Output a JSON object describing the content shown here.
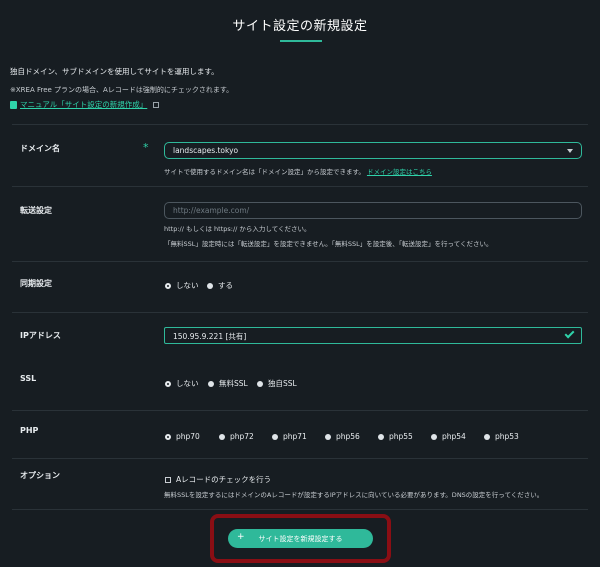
{
  "title": "サイト設定の新規設定",
  "intro": "独自ドメイン、サブドメインを使用してサイトを運用します。",
  "note": "※XREA Free プランの場合、Aレコードは強制的にチェックされます。",
  "manual_link": "マニュアル「サイト設定の新規作成」",
  "domain": {
    "label": "ドメイン名",
    "required_mark": "*",
    "value": "landscapes.tokyo",
    "help": "サイトで使用するドメイン名は「ドメイン設定」から設定できます。",
    "help_link": "ドメイン設定はこちら"
  },
  "redirect": {
    "label": "転送設定",
    "placeholder": "http://example.com/",
    "help1": "http:// もしくは https:// から入力してください。",
    "help2": "「無料SSL」設定時には「転送設定」を設定できません。「無料SSL」を設定後、「転送設定」を行ってください。"
  },
  "sync": {
    "label": "同期設定",
    "options": [
      "しない",
      "する"
    ],
    "selected": "しない"
  },
  "ip": {
    "label": "IPアドレス",
    "value": "150.95.9.221 [共有]"
  },
  "ssl": {
    "label": "SSL",
    "options": [
      "しない",
      "無料SSL",
      "独自SSL"
    ],
    "selected": "しない"
  },
  "php": {
    "label": "PHP",
    "options": [
      "php70",
      "php72",
      "php71",
      "php56",
      "php55",
      "php54",
      "php53"
    ],
    "selected": "php70"
  },
  "option": {
    "label": "オプション",
    "checkbox": "Aレコードのチェックを行う",
    "help": "無料SSLを設定するにはドメインのAレコードが設定するIPアドレスに向いている必要があります。DNSの設定を行ってください。"
  },
  "submit": {
    "plus": "+",
    "label": "サイト設定を新規設定する"
  },
  "colors": {
    "accent": "#2fb99a",
    "highlight": "#8a0e14",
    "background": "#171d22"
  }
}
